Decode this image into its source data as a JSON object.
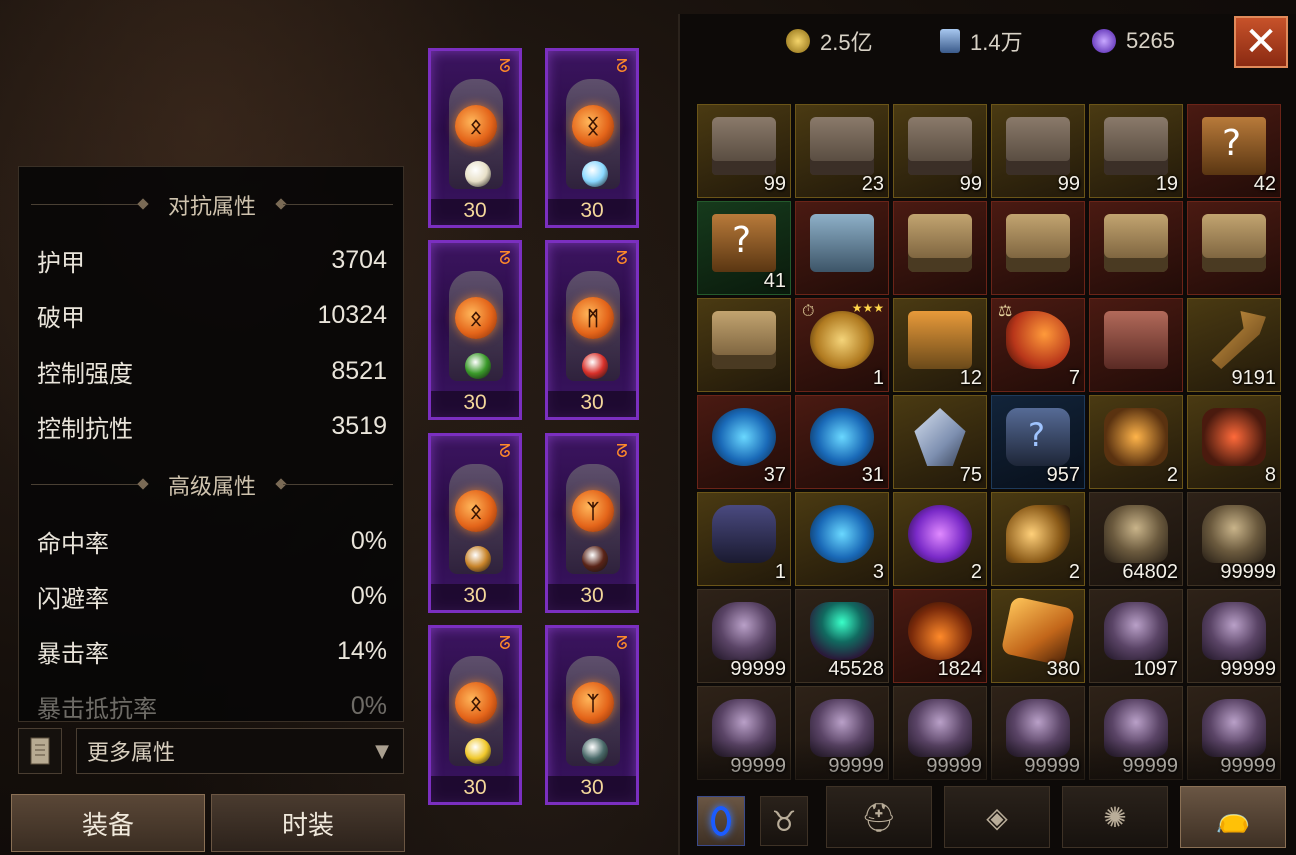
{
  "stats": {
    "section1_title": "对抗属性",
    "section2_title": "高级属性",
    "rows1": [
      {
        "label": "护甲",
        "value": "3704"
      },
      {
        "label": "破甲",
        "value": "10324"
      },
      {
        "label": "控制强度",
        "value": "8521"
      },
      {
        "label": "控制抗性",
        "value": "3519"
      }
    ],
    "rows2": [
      {
        "label": "命中率",
        "value": "0%"
      },
      {
        "label": "闪避率",
        "value": "0%"
      },
      {
        "label": "暴击率",
        "value": "14%"
      },
      {
        "label": "暴击抵抗率",
        "value": "0%"
      }
    ],
    "more_label": "更多属性",
    "more_caret": "▼"
  },
  "tabs": {
    "equip": "装备",
    "fashion": "时装"
  },
  "equipment": {
    "slots": [
      {
        "level": "30",
        "rune": "ᛟ",
        "gem": "#e8e0c8"
      },
      {
        "level": "30",
        "rune": "ᛝ",
        "gem": "#8ad8ff"
      },
      {
        "level": "30",
        "rune": "ᛟ",
        "gem": "#3a9a2a"
      },
      {
        "level": "30",
        "rune": "ᛗ",
        "gem": "#d8302a"
      },
      {
        "level": "30",
        "rune": "ᛟ",
        "gem": "#c8842a"
      },
      {
        "level": "30",
        "rune": "ᛉ",
        "gem": "#5a2418"
      },
      {
        "level": "30",
        "rune": "ᛟ",
        "gem": "#f0c82a"
      },
      {
        "level": "30",
        "rune": "ᛉ",
        "gem": "#4a6a6a"
      }
    ]
  },
  "currency": [
    {
      "name": "gold-coin",
      "value": "2.5亿",
      "color": "#d8b03a"
    },
    {
      "name": "blue-card",
      "value": "1.4万",
      "color": "#7fa8d8"
    },
    {
      "name": "purple-orb",
      "value": "5265",
      "color": "#8a5aff"
    }
  ],
  "close_label": "✕",
  "inventory": [
    {
      "icon": "chest-icon",
      "art": "chest",
      "rarity": "r-gold",
      "count": "99"
    },
    {
      "icon": "chest-icon",
      "art": "chest",
      "rarity": "r-gold",
      "count": "23"
    },
    {
      "icon": "chest-icon",
      "art": "chest",
      "rarity": "r-gold",
      "count": "99"
    },
    {
      "icon": "chest-icon",
      "art": "chest",
      "rarity": "r-gold",
      "count": "99"
    },
    {
      "icon": "chest-icon",
      "art": "chest",
      "rarity": "r-gold",
      "count": "19"
    },
    {
      "icon": "mystery-book-icon",
      "art": "book",
      "rarity": "r-red",
      "count": "42"
    },
    {
      "icon": "mystery-book-icon",
      "art": "book",
      "rarity": "r-green",
      "count": "41"
    },
    {
      "icon": "blue-chest-icon",
      "art": "chest-blue",
      "rarity": "r-red",
      "count": ""
    },
    {
      "icon": "gold-chest-icon",
      "art": "chest-gold",
      "rarity": "r-red",
      "count": ""
    },
    {
      "icon": "gold-chest-icon",
      "art": "chest-gold",
      "rarity": "r-red",
      "count": ""
    },
    {
      "icon": "gold-chest-icon",
      "art": "chest-gold",
      "rarity": "r-red",
      "count": ""
    },
    {
      "icon": "gold-chest-icon",
      "art": "chest-gold",
      "rarity": "r-red",
      "count": ""
    },
    {
      "icon": "gold-chest-icon",
      "art": "chest-gold",
      "rarity": "r-gold",
      "count": ""
    },
    {
      "icon": "egg-bundle-icon",
      "art": "eggs",
      "rarity": "r-red",
      "count": "1",
      "mark": "⏱",
      "stars": "★★★"
    },
    {
      "icon": "orange-chest-icon",
      "art": "chest-orange",
      "rarity": "r-gold",
      "count": "12"
    },
    {
      "icon": "flame-stone-icon",
      "art": "flame",
      "rarity": "r-red",
      "count": "7",
      "mark": "⚖"
    },
    {
      "icon": "red-chest-icon",
      "art": "chest-red",
      "rarity": "r-red",
      "count": ""
    },
    {
      "icon": "key-icon",
      "art": "key",
      "rarity": "r-gold",
      "count": "9191"
    },
    {
      "icon": "blue-orb-icon",
      "art": "orb-blue",
      "rarity": "r-red",
      "count": "37"
    },
    {
      "icon": "blue-orb-icon",
      "art": "orb-blue",
      "rarity": "r-red",
      "count": "31"
    },
    {
      "icon": "crystal-icon",
      "art": "crystal",
      "rarity": "r-gold",
      "count": "75"
    },
    {
      "icon": "mystery-rune-icon",
      "art": "rune-blue",
      "rarity": "r-blue",
      "count": "957"
    },
    {
      "icon": "gold-ore-icon",
      "art": "rock-gold",
      "rarity": "r-gold",
      "count": "2"
    },
    {
      "icon": "red-ore-icon",
      "art": "rock-red",
      "rarity": "r-gold",
      "count": "8"
    },
    {
      "icon": "rune-stone-icon",
      "art": "stone-blue",
      "rarity": "r-gold",
      "count": "1"
    },
    {
      "icon": "blue-orb-icon",
      "art": "orb-blue",
      "rarity": "r-gold",
      "count": "3"
    },
    {
      "icon": "purple-orb-icon",
      "art": "orb-purple",
      "rarity": "r-gold",
      "count": "2"
    },
    {
      "icon": "wing-icon",
      "art": "wing",
      "rarity": "r-gold",
      "count": "2"
    },
    {
      "icon": "helmet-icon",
      "art": "helm",
      "rarity": "",
      "count": "64802"
    },
    {
      "icon": "helmet-icon",
      "art": "helm",
      "rarity": "",
      "count": "99999"
    },
    {
      "icon": "helmet-icon",
      "art": "helm-purple",
      "rarity": "",
      "count": "99999"
    },
    {
      "icon": "cauldron-icon",
      "art": "cauldron",
      "rarity": "",
      "count": "45528"
    },
    {
      "icon": "potion-icon",
      "art": "potion",
      "rarity": "r-red",
      "count": "1824"
    },
    {
      "icon": "amber-icon",
      "art": "amber",
      "rarity": "r-gold",
      "count": "380"
    },
    {
      "icon": "helmet-icon",
      "art": "helm-purple",
      "rarity": "",
      "count": "1097"
    },
    {
      "icon": "helmet-icon",
      "art": "helm-purple",
      "rarity": "",
      "count": "99999"
    },
    {
      "icon": "helmet-icon",
      "art": "helm-purple",
      "rarity": "",
      "count": "99999"
    },
    {
      "icon": "helmet-icon",
      "art": "helm-purple",
      "rarity": "",
      "count": "99999"
    },
    {
      "icon": "helmet-icon",
      "art": "helm-purple",
      "rarity": "",
      "count": "99999"
    },
    {
      "icon": "helmet-icon",
      "art": "helm-purple",
      "rarity": "",
      "count": "99999"
    },
    {
      "icon": "helmet-icon",
      "art": "helm-purple",
      "rarity": "",
      "count": "99999"
    },
    {
      "icon": "helmet-icon",
      "art": "helm-purple",
      "rarity": "",
      "count": "99999"
    }
  ],
  "inventory_tabs": [
    {
      "name": "portal-tab-icon",
      "glyph": ""
    },
    {
      "name": "demon-tab-icon",
      "glyph": "♉"
    },
    {
      "name": "helmet-tab-icon",
      "glyph": "⛑"
    },
    {
      "name": "gem-tab-icon",
      "glyph": "◈"
    },
    {
      "name": "rune-tab-icon",
      "glyph": "✺"
    },
    {
      "name": "bag-tab-icon",
      "glyph": "👝"
    }
  ]
}
